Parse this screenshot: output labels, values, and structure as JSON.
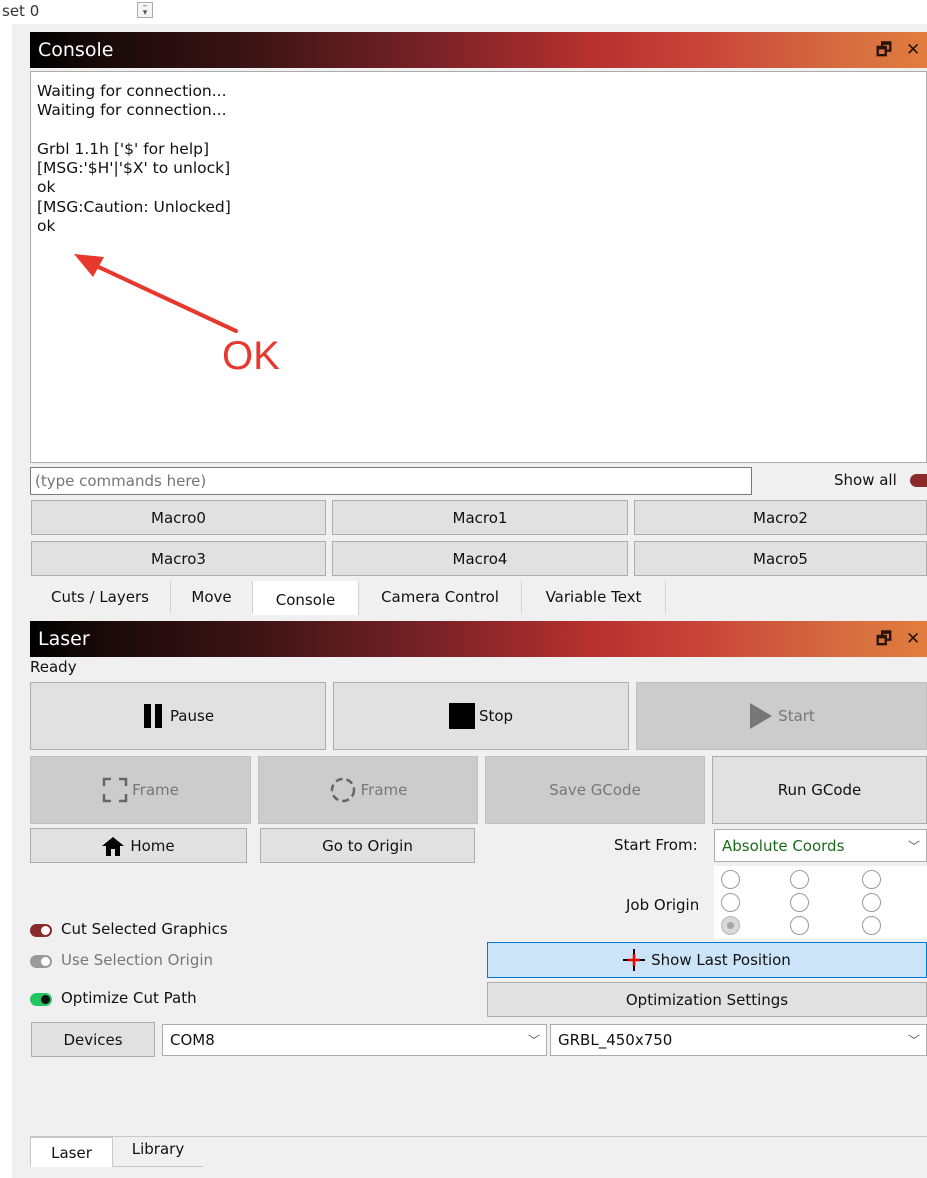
{
  "top": {
    "label": "set 0",
    "spin_icon": "spin-down-icon"
  },
  "console_panel": {
    "title": "Console",
    "output_lines": [
      "Waiting for connection...",
      "Waiting for connection...",
      "",
      "Grbl 1.1h ['$' for help]",
      "[MSG:'$H'|'$X' to unlock]",
      "ok",
      "[MSG:Caution: Unlocked]",
      "ok"
    ],
    "annotation": "OK",
    "annotation_color": "#e8382d",
    "command_placeholder": "(type commands here)",
    "show_all_label": "Show all",
    "macros": [
      "Macro0",
      "Macro1",
      "Macro2",
      "Macro3",
      "Macro4",
      "Macro5"
    ]
  },
  "tabs": [
    {
      "label": "Cuts / Layers",
      "active": false
    },
    {
      "label": "Move",
      "active": false
    },
    {
      "label": "Console",
      "active": true
    },
    {
      "label": "Camera Control",
      "active": false
    },
    {
      "label": "Variable Text",
      "active": false
    }
  ],
  "laser_panel": {
    "title": "Laser",
    "status": "Ready",
    "pause_label": "Pause",
    "stop_label": "Stop",
    "start_label": "Start",
    "frame_rect_label": "Frame",
    "frame_circle_label": "Frame",
    "save_gcode_label": "Save GCode",
    "run_gcode_label": "Run GCode",
    "home_label": "Home",
    "go_to_origin_label": "Go to Origin",
    "start_from_label": "Start From:",
    "start_from_value": "Absolute Coords",
    "start_from_color": "#1a6b1a",
    "job_origin_label": "Job Origin",
    "job_origin_selected": "bottom-left",
    "cut_selected_label": "Cut Selected Graphics",
    "cut_selected_on": true,
    "use_selection_origin_label": "Use Selection Origin",
    "use_selection_origin_on": false,
    "optimize_cut_path_label": "Optimize Cut Path",
    "optimize_cut_path_on": true,
    "show_last_position_label": "Show Last Position",
    "optimization_settings_label": "Optimization Settings",
    "devices_label": "Devices",
    "port_value": "COM8",
    "profile_value": "GRBL_450x750"
  },
  "bottom_tabs": [
    {
      "label": "Laser",
      "active": true
    },
    {
      "label": "Library",
      "active": false
    }
  ],
  "colors": {
    "toggle_on_red": "#8b2a2a",
    "toggle_off": "#9a9a9a",
    "toggle_on_green": "#22c55e",
    "highlight_button": "#cce4f7",
    "highlight_border": "#0078d7"
  }
}
